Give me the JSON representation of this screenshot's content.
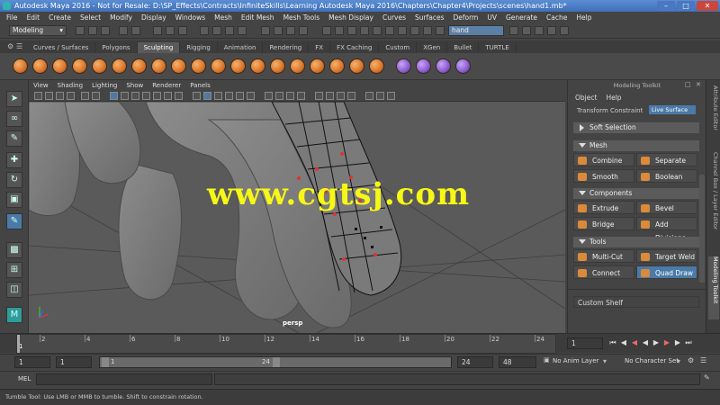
{
  "window": {
    "title": "Autodesk Maya 2016 - Not for Resale: D:\\SP_Effects\\Contracts\\InfiniteSkills\\Learning Autodesk Maya 2016\\Chapters\\Chapter4\\Projects\\scenes\\hand1.mb*"
  },
  "menubar": [
    "File",
    "Edit",
    "Create",
    "Select",
    "Modify",
    "Display",
    "Windows",
    "Mesh",
    "Edit Mesh",
    "Mesh Tools",
    "Mesh Display",
    "Curves",
    "Surfaces",
    "Deform",
    "UV",
    "Generate",
    "Cache",
    "Help"
  ],
  "statusline": {
    "menuset": "Modeling",
    "search_value": "hand"
  },
  "shelf": {
    "tabs": [
      "Curves / Surfaces",
      "Polygons",
      "Sculpting",
      "Rigging",
      "Animation",
      "Rendering",
      "FX",
      "FX Caching",
      "Custom",
      "XGen",
      "Bullet",
      "TURTLE"
    ],
    "active_tab": "Sculpting"
  },
  "viewport": {
    "menu": [
      "View",
      "Shading",
      "Lighting",
      "Show",
      "Renderer",
      "Panels"
    ],
    "camera_label": "persp",
    "watermark": "www.cgtsj.com"
  },
  "modeling_toolkit": {
    "title": "Modeling Toolkit",
    "menu": [
      "Object",
      "Help"
    ],
    "partial_row_label": "Transform Constraint",
    "partial_row_value": "Live Surface",
    "soft_selection": "Soft Selection",
    "sections": [
      {
        "name": "Mesh",
        "buttons": [
          "Combine",
          "Separate",
          "Smooth",
          "Boolean"
        ]
      },
      {
        "name": "Components",
        "buttons": [
          "Extrude",
          "Bevel",
          "Bridge",
          "Add Divisions"
        ]
      },
      {
        "name": "Tools",
        "buttons": [
          "Multi-Cut",
          "Target Weld",
          "Connect",
          "Quad Draw"
        ]
      }
    ],
    "custom_shelf": "Custom Shelf",
    "selected_button": "Quad Draw"
  },
  "side_tabs": [
    "Attribute Editor",
    "Channel Box / Layer Editor",
    "Modeling Toolkit"
  ],
  "timeline": {
    "ticks": [
      "1",
      "2",
      "4",
      "6",
      "8",
      "10",
      "12",
      "14",
      "16",
      "18",
      "20",
      "22",
      "24"
    ],
    "current_frame": "1"
  },
  "range": {
    "start": "1",
    "playback_start": "1",
    "slider_start": "1",
    "slider_end": "24",
    "playback_end": "24",
    "end": "48",
    "anim_layer": "No Anim Layer",
    "character_set": "No Character Set"
  },
  "mel": {
    "label": "MEL"
  },
  "help_line": "Tumble Tool: Use LMB or MMB to tumble. Shift to constrain rotation."
}
